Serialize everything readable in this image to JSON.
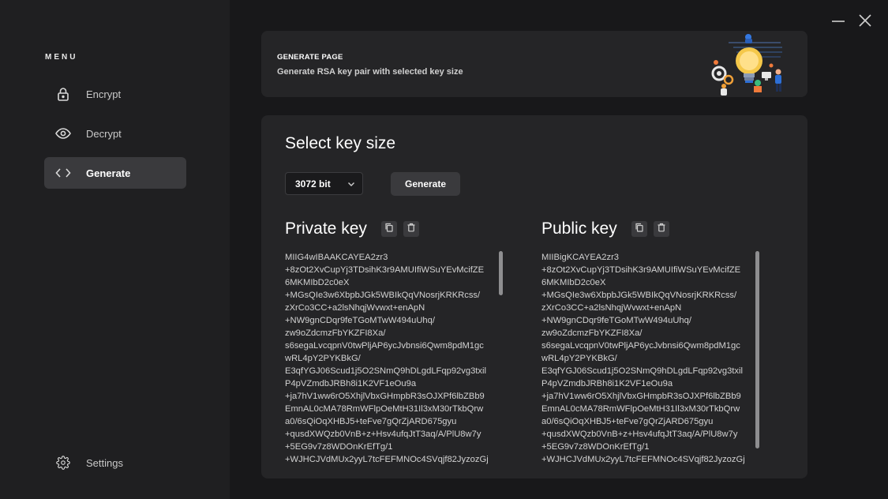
{
  "sidebar": {
    "menu_title": "MENU",
    "items": [
      {
        "label": "Encrypt",
        "icon": "lock-icon",
        "active": false
      },
      {
        "label": "Decrypt",
        "icon": "eye-icon",
        "active": false
      },
      {
        "label": "Generate",
        "icon": "code-brackets-icon",
        "active": true
      }
    ],
    "settings_label": "Settings"
  },
  "header": {
    "title": "GENERATE PAGE",
    "subtitle": "Generate RSA key pair with selected key size"
  },
  "main": {
    "section_title": "Select key size",
    "key_size": "3072 bit",
    "generate_label": "Generate",
    "private_key": {
      "title": "Private key",
      "text": "MIIG4wIBAAKCAYEA2zr3\n+8zOt2XvCupYj3TDsihK3r9AMUIfiWSuYEvMcifZE\n6MKMIbD2c0eX\n+MGsQIe3w6XbpbJGk5WBIkQqVNosrjKRKRcss/\nzXrCo3CC+a2lsNhqjWvwxt+enApN\n+NW9gnCDqr9feTGoMTwW494uUhq/\nzw9oZdcmzFbYKZFI8Xa/\ns6segaLvcqpnV0twPljAP6ycJvbnsi6Qwm8pdM1gc\nwRL4pY2PYKBkG/\nE3qfYGJ06Scud1j5O2SNmQ9hDLgdLFqp92vg3txil\nP4pVZmdbJRBh8i1K2VF1eOu9a\n+ja7hV1ww6rO5XhjlVbxGHmpbR3sOJXPf6lbZBb9\nEmnAL0cMA78RmWFlpOeMtH31Il3xM30rTkbQrw\na0/6sQiOqXHBJ5+teFve7gQrZjARD675gyu\n+qusdXWQzb0VnB+z+Hsv4ufqJtT3aq/A/PlU8w7y\n+5EG9v7z8WDOnKrEfTg/1\n+WJHCJVdMUx2yyL7tcFEFMNOc4SVqjf82JyzozGj"
    },
    "public_key": {
      "title": "Public key",
      "text": "MIIBigKCAYEA2zr3\n+8zOt2XvCupYj3TDsihK3r9AMUIfiWSuYEvMcifZE\n6MKMIbD2c0eX\n+MGsQIe3w6XbpbJGk5WBIkQqVNosrjKRKRcss/\nzXrCo3CC+a2lsNhqjWvwxt+enApN\n+NW9gnCDqr9feTGoMTwW494uUhq/\nzw9oZdcmzFbYKZFI8Xa/\ns6segaLvcqpnV0twPljAP6ycJvbnsi6Qwm8pdM1gc\nwRL4pY2PYKBkG/\nE3qfYGJ06Scud1j5O2SNmQ9hDLgdLFqp92vg3txil\nP4pVZmdbJRBh8i1K2VF1eOu9a\n+ja7hV1ww6rO5XhjlVbxGHmpbR3sOJXPf6lbZBb9\nEmnAL0cMA78RmWFlpOeMtH31Il3xM30rTkbQrw\na0/6sQiOqXHBJ5+teFve7gQrZjARD675gyu\n+qusdXWQzb0VnB+z+Hsv4ufqJtT3aq/A/PlU8w7y\n+5EG9v7z8WDOnKrEfTg/1\n+WJHCJVdMUx2yyL7tcFEFMNOc4SVqjf82JyzozGj"
    }
  },
  "icons": {
    "minimize": "minimize-icon",
    "close": "close-icon",
    "copy": "copy-icon",
    "delete": "trash-icon",
    "settings": "gear-icon",
    "dropdown": "chevron-down-icon"
  }
}
